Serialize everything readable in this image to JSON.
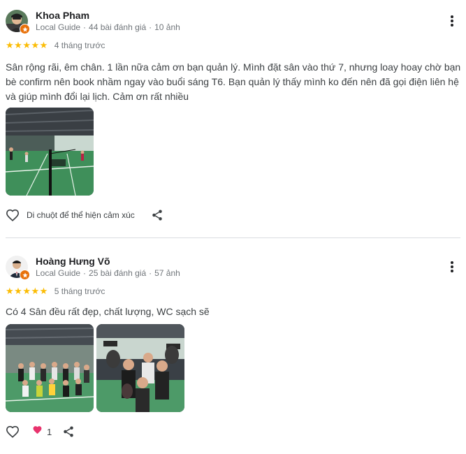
{
  "reviews": [
    {
      "name": "Khoa Pham",
      "badge": "Local Guide",
      "reviews_count": "44 bài đánh giá",
      "photos_count": "10 ảnh",
      "stars": 5,
      "time": "4 tháng trước",
      "text": "Sân rộng rãi, êm chân. 1 lần nữa cảm ơn bạn quản lý. Mình đặt sân vào thứ 7, nhưng loay hoay chờ bạn bè confirm nên book nhầm ngay vào buổi sáng T6. Bạn quản lý thấy mình ko đến nên đã gọi điện liên hệ và giúp mình đổi lại lịch. Cảm ơn rất nhiều",
      "reaction_hint": "Di chuột để thể hiện cảm xúc"
    },
    {
      "name": "Hoàng Hưng Võ",
      "badge": "Local Guide",
      "reviews_count": "25 bài đánh giá",
      "photos_count": "57 ảnh",
      "stars": 5,
      "time": "5 tháng trước",
      "text": "Có 4 Sân đều rất đẹp, chất lượng, WC sạch sẽ",
      "reaction_count": "1"
    }
  ],
  "colors": {
    "star": "#fbbc04",
    "heart_filled": "#e8336d",
    "badge": "#e8710a",
    "muted_text": "#70757a",
    "court_green": "#3f8f5a"
  },
  "icons": [
    "heart-outline-icon",
    "share-icon",
    "more-vert-icon",
    "local-guide-star-icon",
    "heart-filled-icon"
  ]
}
